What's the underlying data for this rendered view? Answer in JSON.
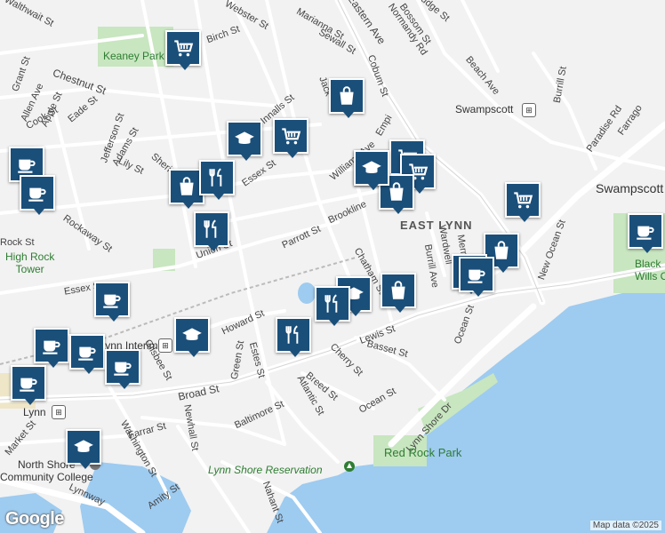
{
  "map": {
    "attribution": "Map data ©2025",
    "logo_text": "Google",
    "neighborhoods": {
      "east_lynn": "EAST LYNN",
      "swampscott": "Swampscott"
    },
    "places": {
      "keaney_park": "Keaney Park",
      "high_rock_tower": "High Rock\nTower",
      "lynn_interim": "Lynn Interim",
      "lynn": "Lynn",
      "north_shore_cc": "North Shore\nCommunity College",
      "swampscott_station": "Swampscott",
      "red_rock_park": "Red Rock Park",
      "lynn_shore_reservation": "Lynn Shore Reservation",
      "black_wills_cliff": "Black\nWills Cli"
    },
    "streets": [
      "Walthwait St",
      "Grant St",
      "Allen Ave",
      "Apple St",
      "Cook St",
      "Chestnut St",
      "Eade St",
      "Jefferson St",
      "Adams St",
      "Lily St",
      "Sheridan",
      "Rockaway St",
      "Rock St",
      "Essex St",
      "Webster St",
      "Birch St",
      "Marianna St",
      "Sewall St",
      "Eastern Ave",
      "Normandy Rd",
      "Bossom St",
      "Cobum St",
      "Mudge St",
      "Beach Ave",
      "Burrill St",
      "Jack",
      "Innalls St",
      "Williams Ave",
      "Empi",
      "Essex St",
      "Parrott St",
      "Brookline",
      "Union St",
      "Howard St",
      "Chatham St",
      "Green St",
      "Estes St",
      "Lewis St",
      "Basset St",
      "Cherry St",
      "Breed St",
      "Atlantic St",
      "Broad St",
      "Ocean St",
      "Baltimore St",
      "Farrar St",
      "Newhall St",
      "Washington St",
      "Amity St",
      "Nahant St",
      "Lynnway",
      "Market St",
      "Lynn Shore Dr",
      "Wardwell",
      "Merrill Ave",
      "Burrill Ave",
      "New Ocean St",
      "Paradise Rd",
      "Gilsbee St",
      "Ocean St",
      "Farrago"
    ],
    "pins": [
      {
        "icon": "grocery-cart-icon"
      },
      {
        "icon": "shopping-bag-icon"
      },
      {
        "icon": "graduation-cap-icon"
      },
      {
        "icon": "grocery-cart-icon"
      },
      {
        "icon": "coffee-cup-icon"
      },
      {
        "icon": "graduation-cap-icon"
      },
      {
        "icon": "grocery-cart-icon"
      },
      {
        "icon": "shopping-bag-icon"
      },
      {
        "icon": "restaurant-icon"
      },
      {
        "icon": "restaurant-icon"
      },
      {
        "icon": "graduation-cap-icon"
      },
      {
        "icon": "grocery-cart-icon"
      },
      {
        "icon": "shopping-bag-icon"
      },
      {
        "icon": "grocery-cart-icon"
      },
      {
        "icon": "coffee-cup-icon"
      },
      {
        "icon": "shopping-bag-icon"
      },
      {
        "icon": "coffee-cup-icon"
      },
      {
        "icon": "coffee-cup-icon"
      },
      {
        "icon": "restaurant-icon"
      },
      {
        "icon": "graduation-cap-icon"
      },
      {
        "icon": "shopping-bag-icon"
      },
      {
        "icon": "coffee-cup-icon"
      },
      {
        "icon": "coffee-cup-icon"
      },
      {
        "icon": "coffee-cup-icon"
      },
      {
        "icon": "graduation-cap-icon"
      },
      {
        "icon": "restaurant-icon"
      },
      {
        "icon": "coffee-cup-icon"
      },
      {
        "icon": "coffee-cup-icon"
      },
      {
        "icon": "coffee-cup-icon"
      },
      {
        "icon": "graduation-cap-icon"
      }
    ]
  }
}
